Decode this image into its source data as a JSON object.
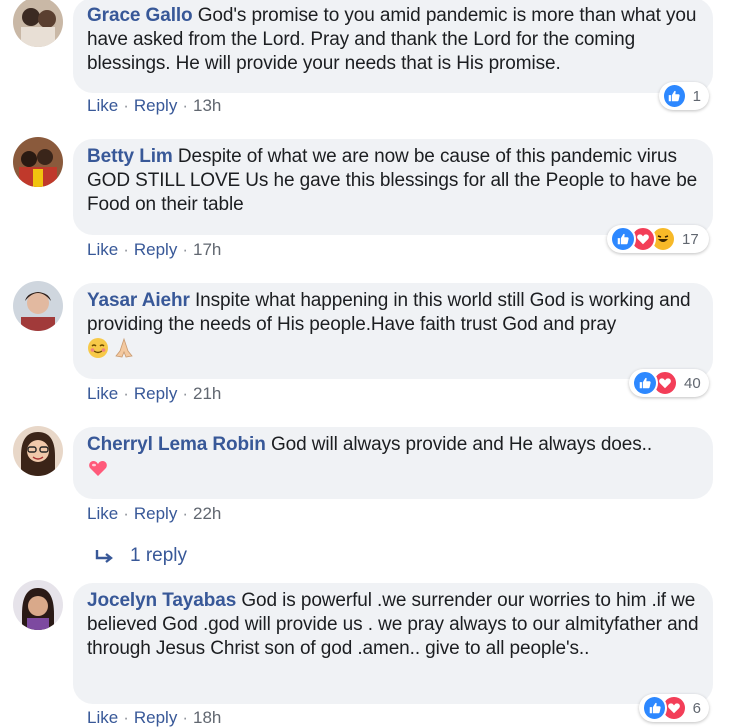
{
  "comments": [
    {
      "author": "Grace Gallo",
      "text": "God's promise to you amid pandemic is more than what you have asked from the Lord. Pray and thank the Lord for the coming blessings. He will provide your needs that is His promise.",
      "like": "Like",
      "reply": "Reply",
      "time": "13h",
      "reaction_count": "1"
    },
    {
      "author": "Betty Lim",
      "text": "Despite of what we are now be cause of this pandemic virus GOD STILL LOVE Us he gave this blessings for all the People to have be Food on their table",
      "like": "Like",
      "reply": "Reply",
      "time": "17h",
      "reaction_count": "17"
    },
    {
      "author": "Yasar Aiehr",
      "text": "Inspite what happening in this world still God is working and providing the needs of His people.Have faith trust God and pray",
      "like": "Like",
      "reply": "Reply",
      "time": "21h",
      "reaction_count": "40"
    },
    {
      "author": "Cherryl Lema Robin",
      "text": "God will always provide and He always does..",
      "like": "Like",
      "reply": "Reply",
      "time": "22h",
      "replies_label": "1 reply"
    },
    {
      "author": "Jocelyn Tayabas",
      "text": "God is powerful .we surrender our worries to him .if we believed God .god will provide us . we pray always to our almityfather and through Jesus Christ son of god .amen.. give to all people's..",
      "like": "Like",
      "reply": "Reply",
      "time": "18h",
      "reaction_count": "6"
    }
  ],
  "colors": {
    "bubble": "#f0f2f5",
    "author": "#385898",
    "like_blue": "#2d88ff",
    "love_red": "#f33e58",
    "haha_yellow": "#f7b928"
  },
  "icons": [
    "like-reaction-icon",
    "love-reaction-icon",
    "haha-reaction-icon",
    "relieved-face-emoji",
    "praying-hands-emoji",
    "heart-emoji",
    "reply-arrow-icon"
  ]
}
